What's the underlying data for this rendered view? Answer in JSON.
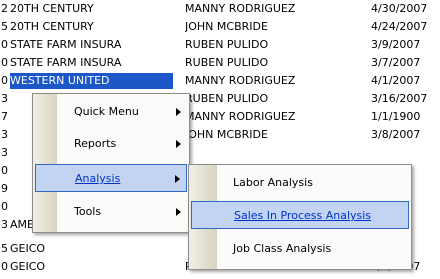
{
  "rows": [
    {
      "idx": "2",
      "customer": "20TH CENTURY",
      "advisor": "MANNY RODRIGUEZ",
      "date": "4/30/2007"
    },
    {
      "idx": "5",
      "customer": "20TH CENTURY",
      "advisor": "JOHN MCBRIDE",
      "date": "4/24/2007"
    },
    {
      "idx": "0",
      "customer": "STATE FARM INSURA",
      "advisor": "RUBEN PULIDO",
      "date": "3/9/2007"
    },
    {
      "idx": "0",
      "customer": "STATE FARM INSURA",
      "advisor": "RUBEN PULIDO",
      "date": "3/7/2007"
    },
    {
      "idx": "0",
      "customer": "WESTERN UNITED",
      "advisor": "MANNY RODRIGUEZ",
      "date": "4/1/2007"
    },
    {
      "idx": "3",
      "customer": "",
      "advisor": "RUBEN PULIDO",
      "date": "3/16/2007"
    },
    {
      "idx": "7",
      "customer": "",
      "advisor": "MANNY RODRIGUEZ",
      "date": "1/1/1900"
    },
    {
      "idx": "3",
      "customer": "",
      "advisor": "JOHN MCBRIDE",
      "date": "3/8/2007"
    },
    {
      "idx": "3",
      "customer": "",
      "advisor": "",
      "date": ""
    },
    {
      "idx": "0",
      "customer": "",
      "advisor": "",
      "date": ""
    },
    {
      "idx": "9",
      "customer": "",
      "advisor": "",
      "date": ""
    },
    {
      "idx": "0",
      "customer": "",
      "advisor": "",
      "date": ""
    },
    {
      "idx": "3",
      "customer": "AMERIPRISE AUTO &",
      "advisor": "",
      "date": ""
    },
    {
      "idx": "5",
      "customer": "GEICO",
      "advisor": "",
      "date": ""
    },
    {
      "idx": "0",
      "customer": "GEICO",
      "advisor": "RUBEN PULIDO",
      "date": "3/6/2007"
    }
  ],
  "context_menu": {
    "items": [
      {
        "label": "Quick Menu",
        "mnemonic": "Q",
        "has_submenu": true
      },
      {
        "label": "Reports",
        "mnemonic": "R",
        "has_submenu": true
      },
      {
        "label": "Analysis",
        "mnemonic": "A",
        "has_submenu": true,
        "highlighted": true
      },
      {
        "label": "Tools",
        "mnemonic": "T",
        "has_submenu": true
      }
    ]
  },
  "submenu": {
    "items": [
      {
        "label": "Labor Analysis",
        "mnemonic": "L"
      },
      {
        "label": "Sales In Process Analysis",
        "mnemonic": "S",
        "highlighted": true
      },
      {
        "label": "Job Class Analysis",
        "mnemonic": "J"
      }
    ]
  },
  "colors": {
    "selection": "#1c57c8",
    "menu_highlight": "#c2d4f2",
    "highlight_border": "#316ac5"
  }
}
